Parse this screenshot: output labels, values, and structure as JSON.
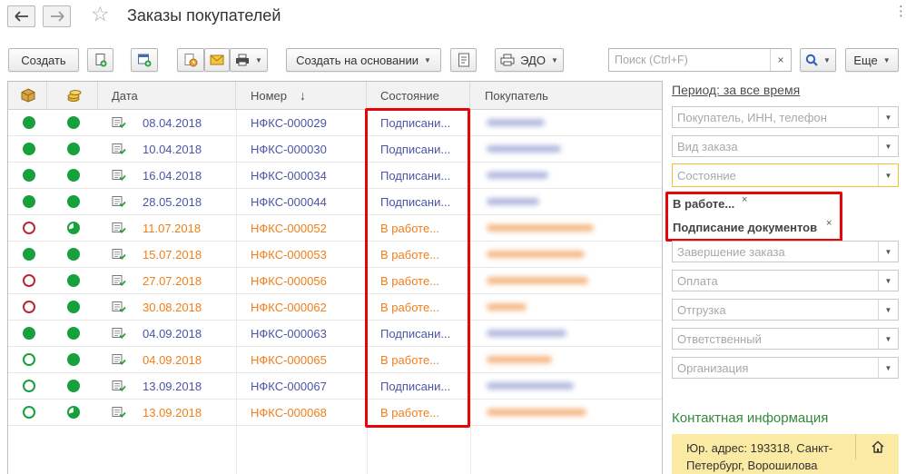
{
  "window": {
    "title": "Заказы покупателей",
    "menu_glyph": "⋮"
  },
  "toolbar": {
    "create_label": "Создать",
    "create_based_label": "Создать на основании",
    "edo_label": "ЭДО",
    "search_placeholder": "Поиск (Ctrl+F)",
    "search_clear": "×",
    "more_label": "Еще"
  },
  "table": {
    "headers": {
      "date": "Дата",
      "number": "Номер",
      "state": "Состояние",
      "buyer": "Покупатель"
    },
    "sort_glyph": "↓",
    "rows": [
      {
        "date": "08.04.2018",
        "number": "НФКС-000029",
        "state": "Подписани...",
        "group": "signing",
        "ship": "filled",
        "pay": "filled"
      },
      {
        "date": "10.04.2018",
        "number": "НФКС-000030",
        "state": "Подписани...",
        "group": "signing",
        "ship": "filled",
        "pay": "filled"
      },
      {
        "date": "16.04.2018",
        "number": "НФКС-000034",
        "state": "Подписани...",
        "group": "signing",
        "ship": "filled",
        "pay": "filled"
      },
      {
        "date": "28.05.2018",
        "number": "НФКС-000044",
        "state": "Подписани...",
        "group": "signing",
        "ship": "filled",
        "pay": "filled"
      },
      {
        "date": "11.07.2018",
        "number": "НФКС-000052",
        "state": "В работе...",
        "group": "in_work",
        "ship": "red-ring",
        "pay": "pie"
      },
      {
        "date": "15.07.2018",
        "number": "НФКС-000053",
        "state": "В работе...",
        "group": "in_work",
        "ship": "filled",
        "pay": "filled"
      },
      {
        "date": "27.07.2018",
        "number": "НФКС-000056",
        "state": "В работе...",
        "group": "in_work",
        "ship": "red-ring",
        "pay": "filled"
      },
      {
        "date": "30.08.2018",
        "number": "НФКС-000062",
        "state": "В работе...",
        "group": "in_work",
        "ship": "red-ring",
        "pay": "filled"
      },
      {
        "date": "04.09.2018",
        "number": "НФКС-000063",
        "state": "Подписани...",
        "group": "signing",
        "ship": "filled",
        "pay": "filled"
      },
      {
        "date": "04.09.2018",
        "number": "НФКС-000065",
        "state": "В работе...",
        "group": "in_work",
        "ship": "green-ring",
        "pay": "filled"
      },
      {
        "date": "13.09.2018",
        "number": "НФКС-000067",
        "state": "Подписани...",
        "group": "signing",
        "ship": "green-ring",
        "pay": "filled"
      },
      {
        "date": "13.09.2018",
        "number": "НФКС-000068",
        "state": "В работе...",
        "group": "in_work",
        "ship": "green-ring",
        "pay": "pie"
      }
    ]
  },
  "filters": {
    "period_link": "Период: за все время",
    "buyer_placeholder": "Покупатель, ИНН, телефон",
    "order_kind_placeholder": "Вид заказа",
    "state_placeholder": "Состояние",
    "selected_states": [
      "В работе...",
      "Подписание документов"
    ],
    "tag_remove_glyph": "×",
    "completion_placeholder": "Завершение заказа",
    "payment_placeholder": "Оплата",
    "shipment_placeholder": "Отгрузка",
    "responsible_placeholder": "Ответственный",
    "organization_placeholder": "Организация"
  },
  "contact": {
    "title": "Контактная информация",
    "address": "Юр. адрес: 193318, Санкт-Петербург, Ворошилова"
  },
  "colors": {
    "signing_text": "#4b55a6",
    "in_work_text": "#f07e1a",
    "status_green": "#17a13d",
    "status_red": "#b8282e",
    "highlight_frame": "#e8050a",
    "contact_title": "#338a3e",
    "contact_bg": "#fbeaa3",
    "active_filter_border": "#f1c232"
  }
}
